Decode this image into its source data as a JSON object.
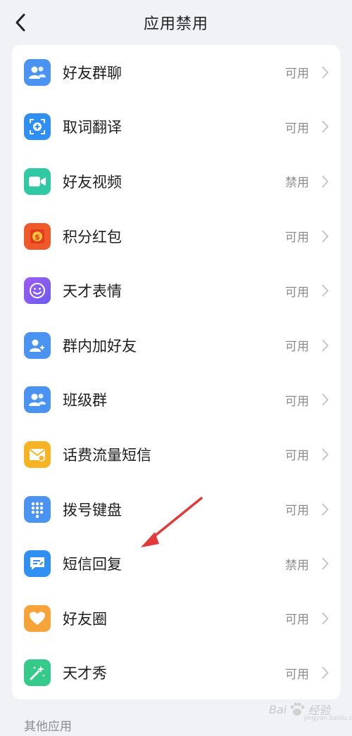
{
  "header": {
    "title": "应用禁用",
    "back_icon": "chevron-left-icon"
  },
  "apps": [
    {
      "name": "好友群聊",
      "status": "可用",
      "icon": "group-chat-icon",
      "color": "#4a93f0"
    },
    {
      "name": "取词翻译",
      "status": "可用",
      "icon": "scan-translate-icon",
      "color": "#2f8ff2"
    },
    {
      "name": "好友视频",
      "status": "禁用",
      "icon": "video-camera-icon",
      "color": "#2fc9a4"
    },
    {
      "name": "积分红包",
      "status": "可用",
      "icon": "red-packet-icon",
      "color": "#ef5a2a"
    },
    {
      "name": "天才表情",
      "status": "可用",
      "icon": "smiley-face-icon",
      "color": "#8a5cf0"
    },
    {
      "name": "群内加好友",
      "status": "可用",
      "icon": "add-friend-icon",
      "color": "#4a93f0"
    },
    {
      "name": "班级群",
      "status": "可用",
      "icon": "class-group-icon",
      "color": "#4a93f0"
    },
    {
      "name": "话费流量短信",
      "status": "可用",
      "icon": "envelope-icon",
      "color": "#f6b324"
    },
    {
      "name": "拨号键盘",
      "status": "可用",
      "icon": "dial-pad-icon",
      "color": "#4a93f0"
    },
    {
      "name": "短信回复",
      "status": "禁用",
      "icon": "message-reply-icon",
      "color": "#2f8ff2"
    },
    {
      "name": "好友圈",
      "status": "可用",
      "icon": "heart-icon",
      "color": "#f6a43a"
    },
    {
      "name": "天才秀",
      "status": "可用",
      "icon": "magic-wand-icon",
      "color": "#35c98a"
    }
  ],
  "section": {
    "other_apps": "其他应用"
  },
  "annotation": {
    "arrow_color": "#e03a3a"
  },
  "watermark": {
    "brand": "Bai",
    "brand_suffix": "经验",
    "sub": "jingyan.baidu.com"
  }
}
